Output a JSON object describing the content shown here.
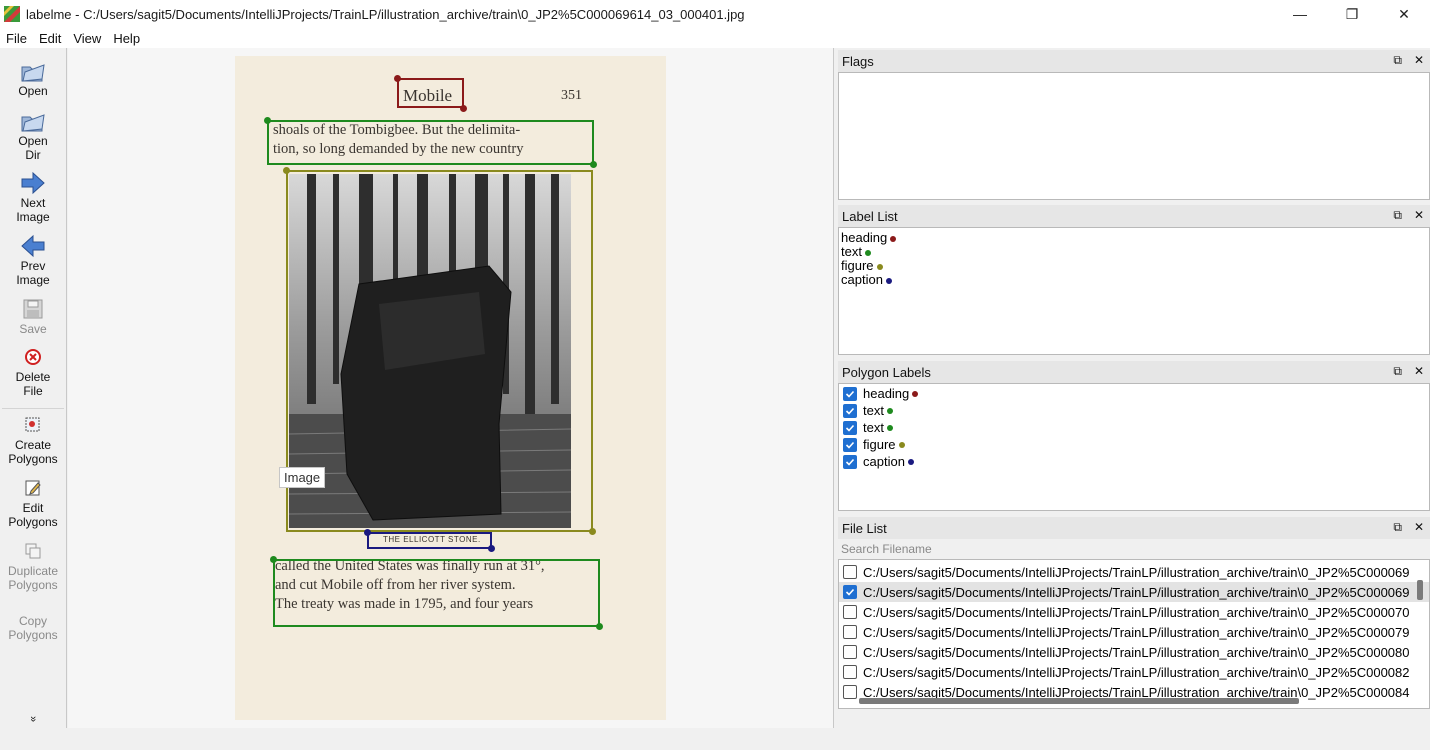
{
  "window": {
    "title": "labelme - C:/Users/sagit5/Documents/IntelliJProjects/TrainLP/illustration_archive/train\\0_JP2%5C000069614_03_000401.jpg",
    "controls": {
      "minimize": "—",
      "restore": "❐",
      "close": "✕"
    }
  },
  "menu": [
    "File",
    "Edit",
    "View",
    "Help"
  ],
  "toolbar": {
    "open": "Open",
    "open_dir": "Open\nDir",
    "next_image": "Next\nImage",
    "prev_image": "Prev\nImage",
    "save": "Save",
    "delete_file": "Delete\nFile",
    "create_polygons": "Create\nPolygons",
    "edit_polygons": "Edit\nPolygons",
    "duplicate_polygons": "Duplicate\nPolygons",
    "copy_polygons": "Copy\nPolygons",
    "more": "»"
  },
  "canvas": {
    "page_number": "351",
    "heading_text": "Mobile",
    "top_text_line1": "shoals of the Tombigbee.  But the delimita-",
    "top_text_line2": "tion, so long demanded by the new country",
    "caption_text": "THE ELLICOTT STONE.",
    "bottom_text_line1": "called the United States was finally run at 31°,",
    "bottom_text_line2": "and cut Mobile off from her river system.",
    "bottom_text_line3": "The treaty was made in 1795, and four years",
    "tooltip": "Image"
  },
  "colors": {
    "heading": "#8b1a1a",
    "text": "#1e8a1e",
    "figure": "#8a8a1e",
    "caption": "#1a1a80"
  },
  "flags": {
    "title": "Flags"
  },
  "label_list": {
    "title": "Label List",
    "items": [
      {
        "name": "heading",
        "color": "#8b1a1a"
      },
      {
        "name": "text",
        "color": "#1e8a1e"
      },
      {
        "name": "figure",
        "color": "#8a8a1e"
      },
      {
        "name": "caption",
        "color": "#1a1a80"
      }
    ]
  },
  "polygon_labels": {
    "title": "Polygon Labels",
    "items": [
      {
        "name": "heading",
        "checked": true,
        "color": "#8b1a1a"
      },
      {
        "name": "text",
        "checked": true,
        "color": "#1e8a1e"
      },
      {
        "name": "text",
        "checked": true,
        "color": "#1e8a1e"
      },
      {
        "name": "figure",
        "checked": true,
        "color": "#8a8a1e"
      },
      {
        "name": "caption",
        "checked": true,
        "color": "#1a1a80"
      }
    ]
  },
  "file_list": {
    "title": "File List",
    "search_placeholder": "Search Filename",
    "files": [
      {
        "path": "C:/Users/sagit5/Documents/IntelliJProjects/TrainLP/illustration_archive/train\\0_JP2%5C000069",
        "checked": false
      },
      {
        "path": "C:/Users/sagit5/Documents/IntelliJProjects/TrainLP/illustration_archive/train\\0_JP2%5C000069",
        "checked": true
      },
      {
        "path": "C:/Users/sagit5/Documents/IntelliJProjects/TrainLP/illustration_archive/train\\0_JP2%5C000070",
        "checked": false
      },
      {
        "path": "C:/Users/sagit5/Documents/IntelliJProjects/TrainLP/illustration_archive/train\\0_JP2%5C000079",
        "checked": false
      },
      {
        "path": "C:/Users/sagit5/Documents/IntelliJProjects/TrainLP/illustration_archive/train\\0_JP2%5C000080",
        "checked": false
      },
      {
        "path": "C:/Users/sagit5/Documents/IntelliJProjects/TrainLP/illustration_archive/train\\0_JP2%5C000082",
        "checked": false
      },
      {
        "path": "C:/Users/sagit5/Documents/IntelliJProjects/TrainLP/illustration_archive/train\\0_JP2%5C000084",
        "checked": false
      }
    ]
  }
}
